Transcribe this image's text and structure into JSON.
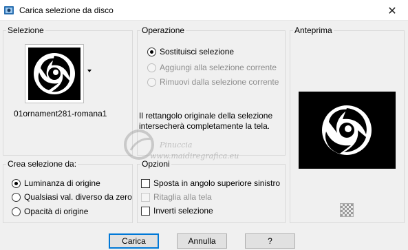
{
  "window": {
    "title": "Carica selezione da disco",
    "close_glyph": "✕"
  },
  "selezione": {
    "label": "Selezione",
    "file_name": "01ornament281-romana1"
  },
  "operazione": {
    "label": "Operazione",
    "options": [
      {
        "label": "Sostituisci selezione",
        "checked": true,
        "enabled": true
      },
      {
        "label": "Aggiungi alla selezione corrente",
        "checked": false,
        "enabled": false
      },
      {
        "label": "Rimuovi dalla selezione corrente",
        "checked": false,
        "enabled": false
      }
    ],
    "info": "Il rettangolo originale della selezione intersecherà completamente la tela."
  },
  "anteprima": {
    "label": "Anteprima"
  },
  "crea": {
    "label": "Crea selezione da:",
    "options": [
      {
        "label": "Luminanza di origine",
        "checked": true
      },
      {
        "label": "Qualsiasi val. diverso da zero",
        "checked": false
      },
      {
        "label": "Opacità di origine",
        "checked": false
      }
    ]
  },
  "opzioni": {
    "label": "Opzioni",
    "items": [
      {
        "label": "Sposta in angolo superiore sinistro",
        "checked": false,
        "enabled": true
      },
      {
        "label": "Ritaglia alla tela",
        "checked": false,
        "enabled": false
      },
      {
        "label": "Inverti selezione",
        "checked": false,
        "enabled": true
      }
    ]
  },
  "buttons": {
    "ok": "Carica",
    "cancel": "Annulla",
    "help": "?"
  },
  "watermark": {
    "line1": "Pinuccia",
    "line2": "www.maidiregrafica.eu"
  },
  "icons": {
    "app": "selection-disk-icon",
    "close": "close-icon",
    "dropdown": "chevron-down-icon",
    "background": "checkerboard-icon"
  },
  "colors": {
    "dialog_bg": "#f0f0f0",
    "default_button_border": "#0078d7",
    "preview_bg": "#000000"
  }
}
